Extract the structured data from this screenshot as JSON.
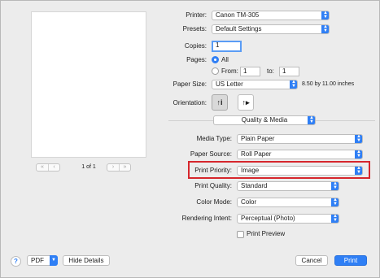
{
  "pager": {
    "first": "«",
    "prev": "‹",
    "next": "›",
    "last": "»",
    "page_text": "1 of 1"
  },
  "printer": {
    "label": "Printer:",
    "value": "Canon TM-305"
  },
  "presets": {
    "label": "Presets:",
    "value": "Default Settings"
  },
  "copies": {
    "label": "Copies:",
    "value": "1"
  },
  "pages": {
    "label": "Pages:",
    "all_label": "All",
    "from_label": "From:",
    "from_value": "1",
    "to_label": "to:",
    "to_value": "1"
  },
  "paper_size": {
    "label": "Paper Size:",
    "value": "US Letter",
    "dimensions": "8.50 by 11.00 inches"
  },
  "orientation": {
    "label": "Orientation:",
    "portrait_glyph": "↑i",
    "landscape_glyph": "↑▸"
  },
  "section": {
    "value": "Quality & Media"
  },
  "media_type": {
    "label": "Media Type:",
    "value": "Plain Paper"
  },
  "paper_source": {
    "label": "Paper Source:",
    "value": "Roll Paper"
  },
  "print_priority": {
    "label": "Print Priority:",
    "value": "Image"
  },
  "print_quality": {
    "label": "Print Quality:",
    "value": "Standard"
  },
  "color_mode": {
    "label": "Color Mode:",
    "value": "Color"
  },
  "rendering_intent": {
    "label": "Rendering Intent:",
    "value": "Perceptual (Photo)"
  },
  "print_preview": {
    "label": "Print Preview"
  },
  "footer": {
    "help": "?",
    "pdf": "PDF",
    "hide_details": "Hide Details",
    "cancel": "Cancel",
    "print": "Print"
  },
  "colors": {
    "accent": "#2f7ff5",
    "highlight": "#d6262c"
  }
}
